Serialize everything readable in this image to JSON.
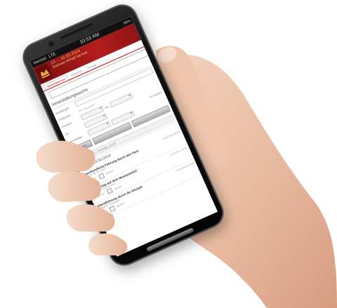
{
  "status": {
    "carrier": "Verizon",
    "network": "LTE",
    "time": "10:53 AM",
    "battery": "96%"
  },
  "header": {
    "banner_line1": "13. – 16.03.2014",
    "banner_line2": "Sachsen-Anhalt hat was"
  },
  "tabs": [
    "Veranstaltungen",
    "Besuchen",
    "Kontakt"
  ],
  "search": {
    "placeholder": ""
  },
  "section": {
    "title": "Veranstaltungssuche"
  },
  "form": {
    "row1": {
      "label": "Suchbegriff",
      "hint": ""
    },
    "row2": {
      "label": "Zielgruppe",
      "value": "",
      "hint": "Alle Zielgruppen"
    },
    "row3": {
      "label": "Zeitraum",
      "bis": "bis"
    },
    "row4": {
      "label": "Ort",
      "link": "Ort wählen"
    },
    "row5": {
      "label": "Veranstalter"
    }
  },
  "buttons": {
    "search": "Suchen",
    "reset": "",
    "more": ""
  },
  "datebar": {
    "text": "Freitag, 14.03. – Sonntag, 16.03."
  },
  "day": {
    "title": "Freitag, 14.03.2014"
  },
  "events": [
    {
      "title": "Naturkundliche Führung durch den Park",
      "sub": "Erleben Sie die Natur",
      "meta": "9 - 12 Uhr",
      "checkbox_label": "Merken",
      "side": "14.03.2014 09:00"
    },
    {
      "title": "Familientag auf dem Museumshof",
      "sub": "Für Kinder und Familien",
      "meta": "10 - 16 Uhr",
      "checkbox_label": "Merken",
      "side": "14.03.2014 10:00"
    },
    {
      "title": "Abendführung durch die Altstadt",
      "sub": "Treffpunkt: Marktplatz",
      "meta": "18 Uhr",
      "checkbox_label": "Merken",
      "side": "14.03.2014 18:00"
    }
  ]
}
